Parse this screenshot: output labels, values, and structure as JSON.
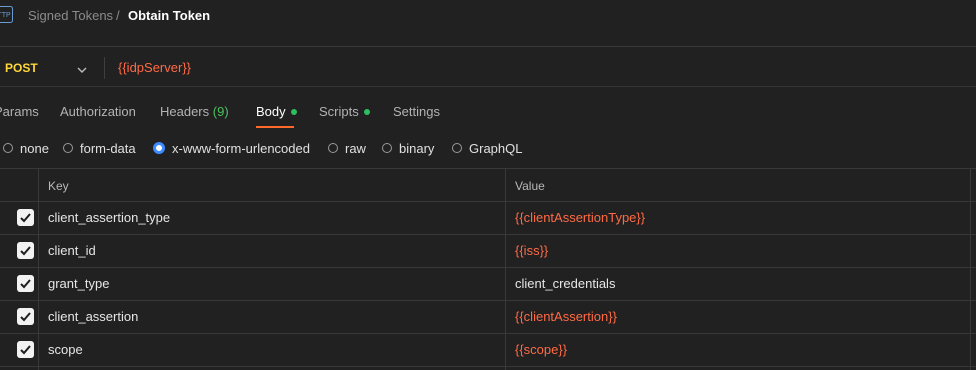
{
  "breadcrumb": {
    "parent": "Signed Tokens",
    "separator": "/",
    "current": "Obtain Token"
  },
  "request": {
    "method": "POST",
    "url": "{{idpServer}}"
  },
  "tabs": [
    {
      "label": "Params"
    },
    {
      "label": "Authorization"
    },
    {
      "label": "Headers",
      "count": "(9)"
    },
    {
      "label": "Body",
      "active": true
    },
    {
      "label": "Scripts"
    },
    {
      "label": "Settings"
    }
  ],
  "body_types": [
    {
      "label": "none",
      "selected": false
    },
    {
      "label": "form-data",
      "selected": false
    },
    {
      "label": "x-www-form-urlencoded",
      "selected": true
    },
    {
      "label": "raw",
      "selected": false
    },
    {
      "label": "binary",
      "selected": false
    },
    {
      "label": "GraphQL",
      "selected": false
    }
  ],
  "table": {
    "headers": {
      "key": "Key",
      "value": "Value"
    },
    "rows": [
      {
        "key": "client_assertion_type",
        "value": "{{clientAssertionType}}",
        "checked": true
      },
      {
        "key": "client_id",
        "value": "{{iss}}",
        "checked": true
      },
      {
        "key": "grant_type",
        "value": "client_credentials",
        "checked": true
      },
      {
        "key": "client_assertion",
        "value": "{{clientAssertion}}",
        "checked": true
      },
      {
        "key": "scope",
        "value": "{{scope}}",
        "checked": true
      }
    ]
  },
  "colors": {
    "variable": "#ff6a45",
    "method": "#ffd73a",
    "active_tab_underline": "#ff6a2a",
    "status_dot": "#2dbe60"
  },
  "icons": {
    "request_type": "http-icon",
    "method_dropdown": "chevron-down-icon",
    "row_checkbox": "checkbox-checked-icon"
  }
}
